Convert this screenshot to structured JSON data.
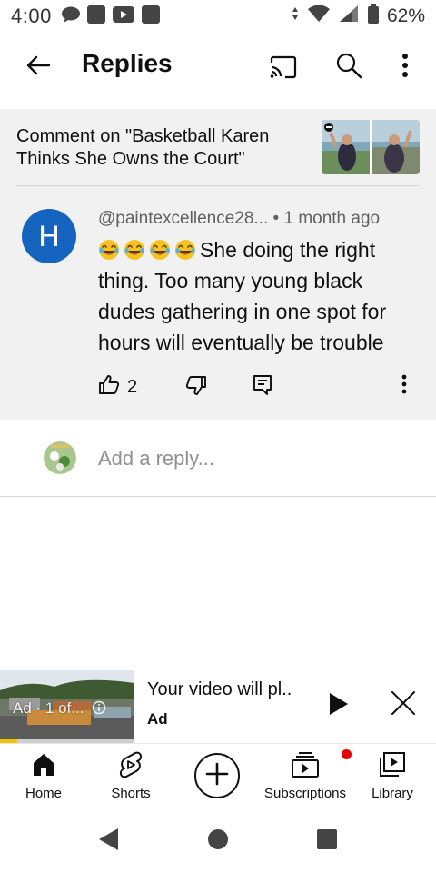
{
  "status_bar": {
    "time": "4:00",
    "battery": "62%",
    "icons": [
      "chat-bubble-icon",
      "notification-square-icon",
      "youtube-icon",
      "notification-square-icon",
      "wifi-icon",
      "signal-icon",
      "battery-icon"
    ]
  },
  "app_bar": {
    "title": "Replies",
    "icons": [
      "back-arrow-icon",
      "cast-icon",
      "search-icon",
      "more-vert-icon"
    ]
  },
  "context": {
    "text": "Comment on \"Basketball Karen Thinks She Owns the Court\""
  },
  "comment": {
    "avatar_letter": "H",
    "avatar_color": "#1565c0",
    "author": "@paintexcellence28...",
    "separator": "•",
    "time": "1 month ago",
    "emoji_count": 4,
    "text": "She doing the right thing. Too many young black dudes gathering in one spot for hours will eventually be trouble",
    "likes": "2"
  },
  "reply_box": {
    "placeholder": "Add a reply..."
  },
  "mini_player": {
    "overlay": "Ad · 1 of...",
    "title": "Your video will pl..",
    "subtitle": "Ad",
    "ad_progress_fraction": 0.13,
    "progress_color": "#f2c200"
  },
  "bottom_nav": {
    "items": [
      {
        "label": "Home",
        "icon": "home-icon"
      },
      {
        "label": "Shorts",
        "icon": "shorts-icon"
      },
      {
        "label": "",
        "icon": "create-icon"
      },
      {
        "label": "Subscriptions",
        "icon": "subscriptions-icon"
      },
      {
        "label": "Library",
        "icon": "library-icon"
      }
    ],
    "badge_color": "#e60000"
  }
}
